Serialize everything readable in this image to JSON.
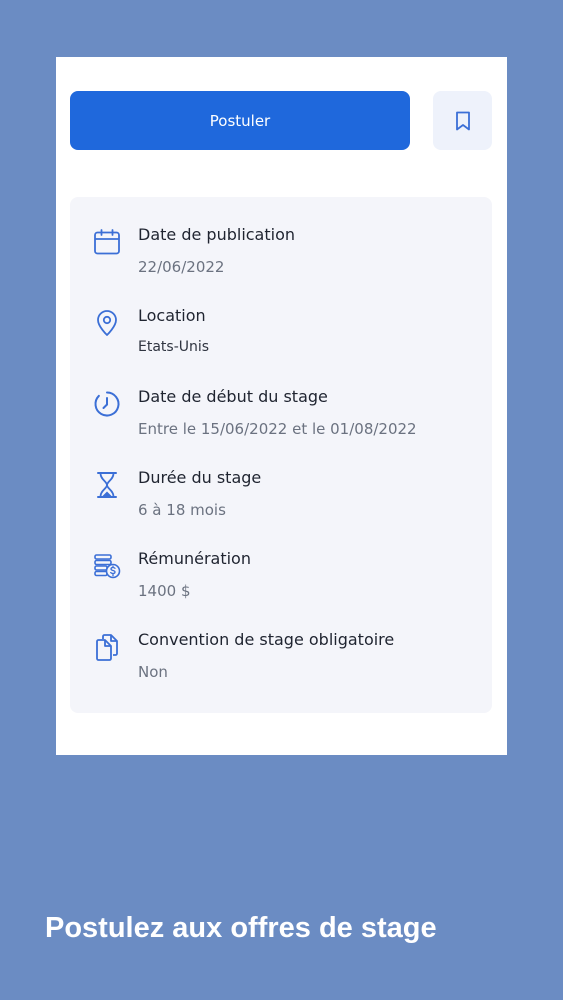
{
  "actions": {
    "apply_label": "Postuler"
  },
  "details": {
    "items": [
      {
        "icon": "calendar-icon",
        "label": "Date de publication",
        "value": "22/06/2022"
      },
      {
        "icon": "location-pin-icon",
        "label": "Location",
        "value": "Etats-Unis"
      },
      {
        "icon": "clock-icon",
        "label": "Date de début du stage",
        "value": "Entre le 15/06/2022 et le 01/08/2022"
      },
      {
        "icon": "hourglass-icon",
        "label": "Durée du stage",
        "value": "6 à 18 mois"
      },
      {
        "icon": "coins-icon",
        "label": "Rémunération",
        "value": "1400 $"
      },
      {
        "icon": "documents-icon",
        "label": "Convention de stage obligatoire",
        "value": "Non"
      }
    ]
  },
  "caption": {
    "text": "Postulez aux offres de stage"
  },
  "colors": {
    "background": "#6b8cc3",
    "primary": "#1f68dc",
    "icon": "#3b6fd6",
    "panel": "#f4f5fa"
  }
}
